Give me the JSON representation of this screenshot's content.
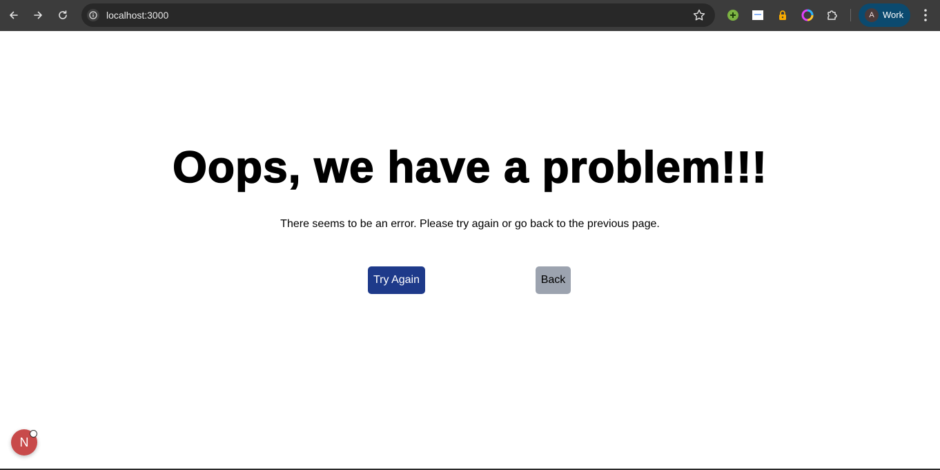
{
  "browser": {
    "url": "localhost:3000",
    "profile_initial": "A",
    "profile_label": "Work",
    "accent_profile": "#0b4a6f"
  },
  "page": {
    "heading": "Oops, we have a problem!!!",
    "message": "There seems to be an error. Please try again or go back to the previous page.",
    "try_again_label": "Try Again",
    "back_label": "Back",
    "primary_color": "#1e3a8a",
    "secondary_color": "#9ca3af"
  },
  "dev_badge": {
    "letter": "N"
  }
}
